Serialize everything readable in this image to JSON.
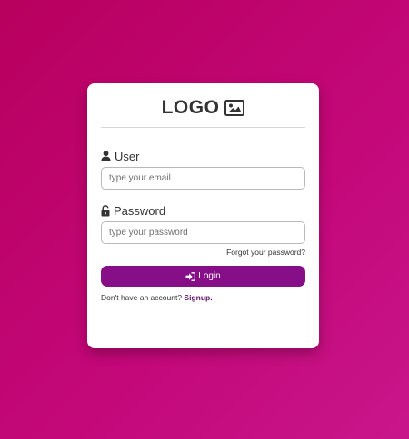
{
  "logo": {
    "text": "LOGO",
    "icon": "image-icon"
  },
  "form": {
    "user": {
      "label": "User",
      "icon": "user-icon",
      "placeholder": "type your email",
      "value": ""
    },
    "password": {
      "label": "Password",
      "icon": "unlock-icon",
      "placeholder": "type your password",
      "value": ""
    },
    "forgot_label": "Forgot your password?",
    "login": {
      "label": "Login",
      "icon": "sign-in-icon"
    },
    "signup": {
      "prompt": "Don't have an account?",
      "link_label": "Signup."
    }
  },
  "colors": {
    "background_start": "#b8005e",
    "background_end": "#c8168a",
    "button": "#860f87",
    "signup_link": "#5a0f66",
    "text": "#333333"
  }
}
